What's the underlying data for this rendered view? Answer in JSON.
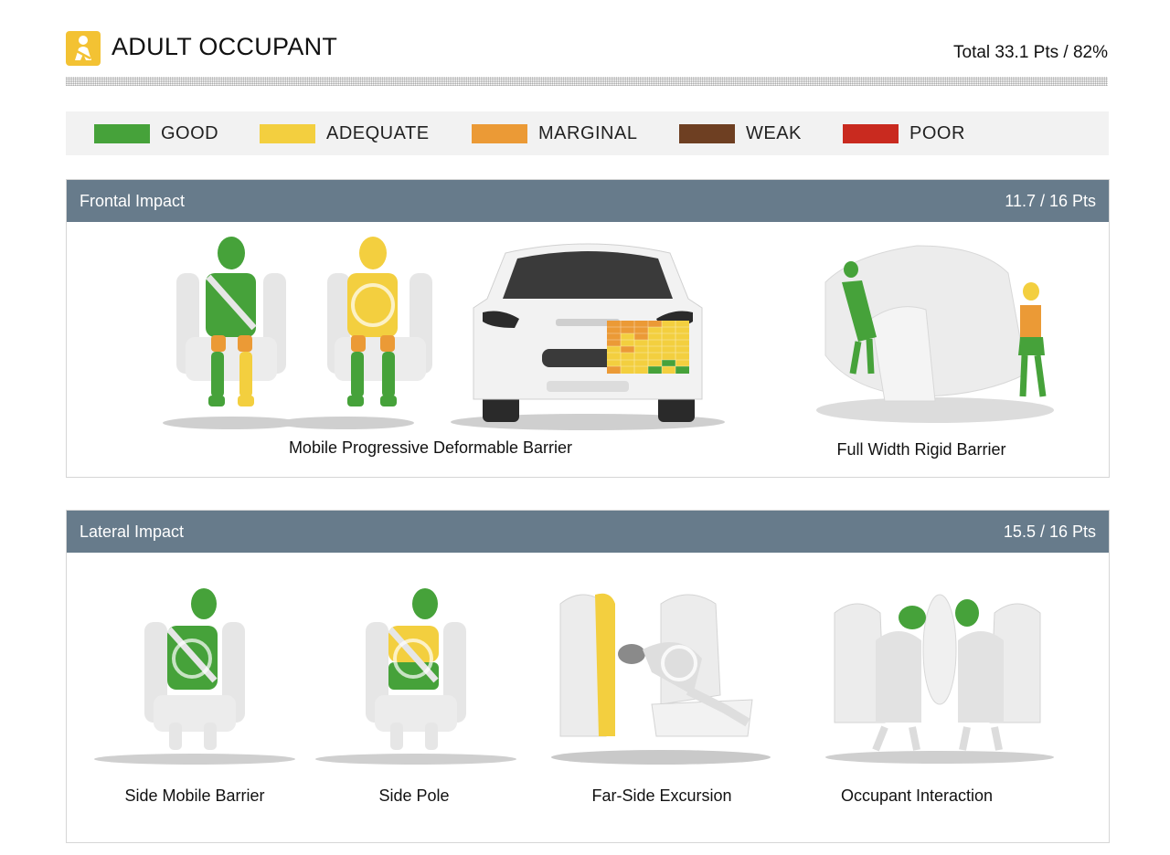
{
  "header": {
    "icon": "seated-occupant-icon",
    "title": "ADULT OCCUPANT",
    "total": "Total 33.1 Pts / 82%"
  },
  "legend": [
    {
      "label": "GOOD",
      "color": "#46a23a"
    },
    {
      "label": "ADEQUATE",
      "color": "#f3cf3f"
    },
    {
      "label": "MARGINAL",
      "color": "#eb9a36"
    },
    {
      "label": "WEAK",
      "color": "#6e3f22"
    },
    {
      "label": "POOR",
      "color": "#c92a1f"
    }
  ],
  "frontal": {
    "title": "Frontal Impact",
    "score": "11.7 / 16 Pts",
    "captions": {
      "mpdb": "Mobile Progressive Deformable Barrier",
      "fwrb": "Full Width Rigid Barrier"
    }
  },
  "lateral": {
    "title": "Lateral Impact",
    "score": "15.5 / 16 Pts",
    "captions": {
      "side_mobile": "Side Mobile Barrier",
      "side_pole": "Side Pole",
      "far_side": "Far-Side Excursion",
      "occupant_interaction": "Occupant Interaction"
    }
  },
  "colors": {
    "good": "#46a23a",
    "adequate": "#f3cf3f",
    "marginal": "#eb9a36",
    "header_bar": "#677b8b",
    "icon_bg": "#f3c233"
  }
}
